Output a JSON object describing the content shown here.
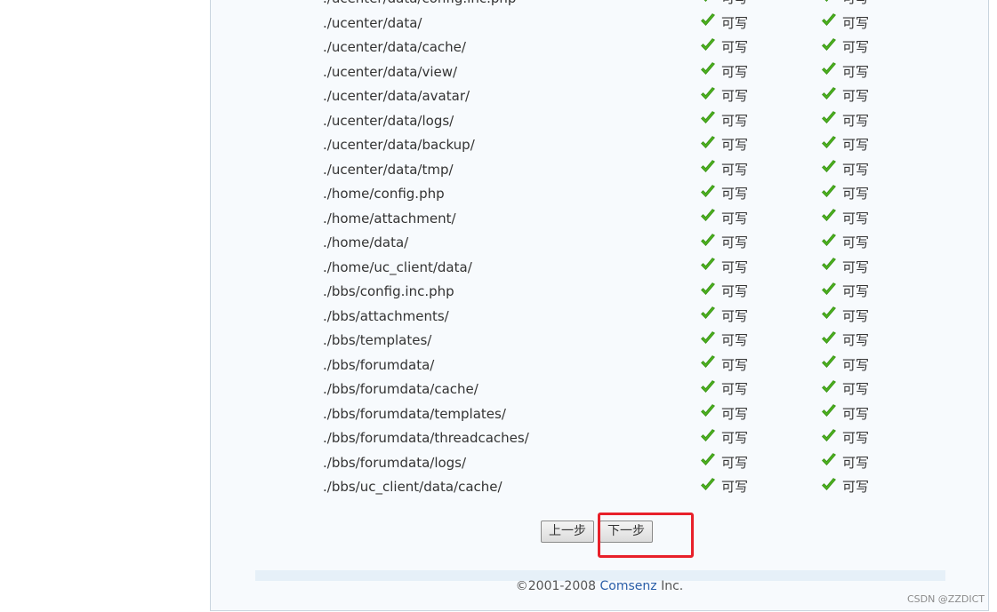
{
  "file_list": {
    "rows": [
      {
        "path": "./ucenter/data/config.inc.php",
        "current": "可写",
        "required": "可写"
      },
      {
        "path": "./ucenter/data/",
        "current": "可写",
        "required": "可写"
      },
      {
        "path": "./ucenter/data/cache/",
        "current": "可写",
        "required": "可写"
      },
      {
        "path": "./ucenter/data/view/",
        "current": "可写",
        "required": "可写"
      },
      {
        "path": "./ucenter/data/avatar/",
        "current": "可写",
        "required": "可写"
      },
      {
        "path": "./ucenter/data/logs/",
        "current": "可写",
        "required": "可写"
      },
      {
        "path": "./ucenter/data/backup/",
        "current": "可写",
        "required": "可写"
      },
      {
        "path": "./ucenter/data/tmp/",
        "current": "可写",
        "required": "可写"
      },
      {
        "path": "./home/config.php",
        "current": "可写",
        "required": "可写"
      },
      {
        "path": "./home/attachment/",
        "current": "可写",
        "required": "可写"
      },
      {
        "path": "./home/data/",
        "current": "可写",
        "required": "可写"
      },
      {
        "path": "./home/uc_client/data/",
        "current": "可写",
        "required": "可写"
      },
      {
        "path": "./bbs/config.inc.php",
        "current": "可写",
        "required": "可写"
      },
      {
        "path": "./bbs/attachments/",
        "current": "可写",
        "required": "可写"
      },
      {
        "path": "./bbs/templates/",
        "current": "可写",
        "required": "可写"
      },
      {
        "path": "./bbs/forumdata/",
        "current": "可写",
        "required": "可写"
      },
      {
        "path": "./bbs/forumdata/cache/",
        "current": "可写",
        "required": "可写"
      },
      {
        "path": "./bbs/forumdata/templates/",
        "current": "可写",
        "required": "可写"
      },
      {
        "path": "./bbs/forumdata/threadcaches/",
        "current": "可写",
        "required": "可写"
      },
      {
        "path": "./bbs/forumdata/logs/",
        "current": "可写",
        "required": "可写"
      },
      {
        "path": "./bbs/uc_client/data/cache/",
        "current": "可写",
        "required": "可写"
      }
    ],
    "status_icon": "check-icon",
    "check_color": "#4caf1e"
  },
  "buttons": {
    "prev_label": "上一步",
    "next_label": "下一步"
  },
  "highlight_color": "#e8202a",
  "footer": {
    "copyright": "©2001-2008",
    "company": "Comsenz",
    "suffix": "Inc."
  },
  "watermark": "CSDN @ZZDICT"
}
